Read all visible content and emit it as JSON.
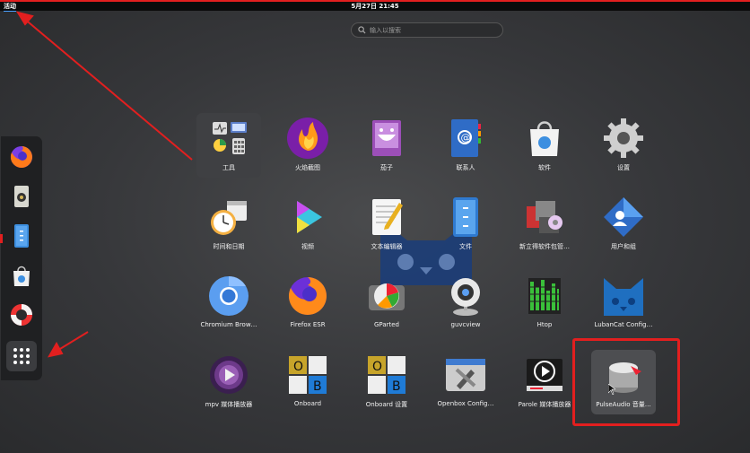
{
  "topbar": {
    "activities": "活动",
    "clock": "5月27日 21:45"
  },
  "search": {
    "placeholder": "输入以搜索"
  },
  "dash": {
    "items": [
      "firefox-icon",
      "speaker-icon",
      "files-icon",
      "software-icon",
      "help-icon",
      "show-apps-icon"
    ]
  },
  "apps": [
    {
      "label": "工具",
      "icon": "utilities-folder-icon"
    },
    {
      "label": "火焰截图",
      "icon": "flameshot-icon"
    },
    {
      "label": "茄子",
      "icon": "cheese-icon"
    },
    {
      "label": "联系人",
      "icon": "contacts-icon"
    },
    {
      "label": "软件",
      "icon": "software-icon"
    },
    {
      "label": "设置",
      "icon": "settings-gear-icon"
    },
    {
      "label": "时间和日期",
      "icon": "clock-calendar-icon"
    },
    {
      "label": "视频",
      "icon": "videos-icon"
    },
    {
      "label": "文本编辑器",
      "icon": "text-editor-icon"
    },
    {
      "label": "文件",
      "icon": "files-icon"
    },
    {
      "label": "新立得软件包管…",
      "icon": "synaptic-icon"
    },
    {
      "label": "用户和组",
      "icon": "users-groups-icon"
    },
    {
      "label": "Chromium Brow…",
      "icon": "chromium-icon"
    },
    {
      "label": "Firefox ESR",
      "icon": "firefox-icon"
    },
    {
      "label": "GParted",
      "icon": "gparted-icon"
    },
    {
      "label": "guvcview",
      "icon": "webcam-icon"
    },
    {
      "label": "Htop",
      "icon": "htop-icon"
    },
    {
      "label": "LubanCat Config…",
      "icon": "lubancat-icon"
    },
    {
      "label": "mpv 媒体播放器",
      "icon": "mpv-icon"
    },
    {
      "label": "Onboard",
      "icon": "onboard-keyboard-icon"
    },
    {
      "label": "Onboard 设置",
      "icon": "onboard-settings-icon"
    },
    {
      "label": "Openbox Config…",
      "icon": "openbox-config-icon"
    },
    {
      "label": "Parole 媒体播放器",
      "icon": "parole-icon"
    },
    {
      "label": "PulseAudio 音量…",
      "icon": "pulseaudio-icon"
    }
  ],
  "colors": {
    "annotation": "#e21f1f",
    "topbar": "#0b0b0b"
  }
}
